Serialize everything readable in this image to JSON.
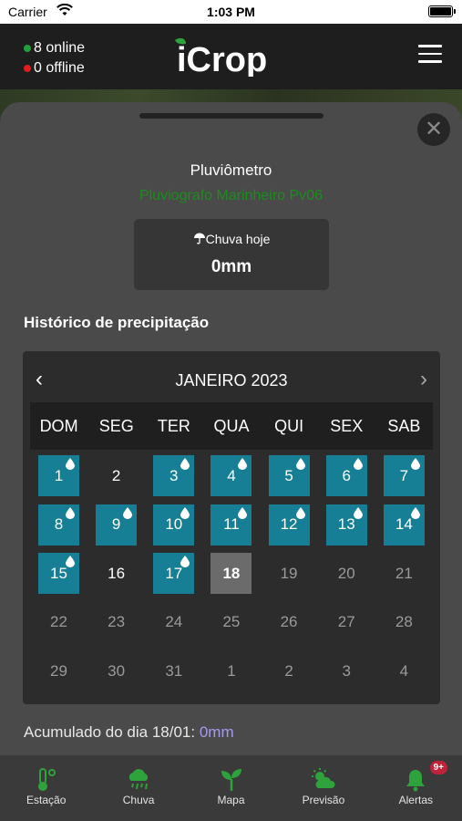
{
  "status_bar": {
    "carrier": "Carrier",
    "time": "1:03 PM"
  },
  "header": {
    "online": "8 online",
    "offline": "0 offline",
    "logo_text": "iCrop",
    "colors": {
      "online_dot": "#1fa23a",
      "offline_dot": "#e01e1e",
      "logo_green": "#2fa33b"
    }
  },
  "modal": {
    "title": "Pluviômetro",
    "subtitle": "Pluviografo Marinheiro Pv06",
    "rain_today_label": "Chuva hoje",
    "rain_today_value": "0mm",
    "history_title": "Histórico de precipitação",
    "accumulated_label": "Acumulado do dia 18/01:",
    "accumulated_value": "0mm"
  },
  "calendar": {
    "month": "JANEIRO 2023",
    "weekdays": [
      "DOM",
      "SEG",
      "TER",
      "QUA",
      "QUI",
      "SEX",
      "SAB"
    ],
    "weeks": [
      [
        {
          "d": "1",
          "s": "rain"
        },
        {
          "d": "2",
          "s": "plain"
        },
        {
          "d": "3",
          "s": "rain"
        },
        {
          "d": "4",
          "s": "rain"
        },
        {
          "d": "5",
          "s": "rain"
        },
        {
          "d": "6",
          "s": "rain"
        },
        {
          "d": "7",
          "s": "rain"
        }
      ],
      [
        {
          "d": "8",
          "s": "rain"
        },
        {
          "d": "9",
          "s": "rain"
        },
        {
          "d": "10",
          "s": "rain"
        },
        {
          "d": "11",
          "s": "rain"
        },
        {
          "d": "12",
          "s": "rain"
        },
        {
          "d": "13",
          "s": "rain"
        },
        {
          "d": "14",
          "s": "rain"
        }
      ],
      [
        {
          "d": "15",
          "s": "rain"
        },
        {
          "d": "16",
          "s": "plain"
        },
        {
          "d": "17",
          "s": "rain"
        },
        {
          "d": "18",
          "s": "today"
        },
        {
          "d": "19",
          "s": "muted"
        },
        {
          "d": "20",
          "s": "muted"
        },
        {
          "d": "21",
          "s": "muted"
        }
      ],
      [
        {
          "d": "22",
          "s": "muted"
        },
        {
          "d": "23",
          "s": "muted"
        },
        {
          "d": "24",
          "s": "muted"
        },
        {
          "d": "25",
          "s": "muted"
        },
        {
          "d": "26",
          "s": "muted"
        },
        {
          "d": "27",
          "s": "muted"
        },
        {
          "d": "28",
          "s": "muted"
        }
      ],
      [
        {
          "d": "29",
          "s": "muted"
        },
        {
          "d": "30",
          "s": "muted"
        },
        {
          "d": "31",
          "s": "muted"
        },
        {
          "d": "1",
          "s": "muted"
        },
        {
          "d": "2",
          "s": "muted"
        },
        {
          "d": "3",
          "s": "muted"
        },
        {
          "d": "4",
          "s": "muted"
        }
      ]
    ],
    "colors": {
      "rain_day": "#167f95",
      "selected_day": "#6b6b6b"
    }
  },
  "tabs": [
    {
      "label": "Estação",
      "icon": "thermometer-icon"
    },
    {
      "label": "Chuva",
      "icon": "rain-cloud-icon"
    },
    {
      "label": "Mapa",
      "icon": "sprout-icon"
    },
    {
      "label": "Previsão",
      "icon": "sun-cloud-icon"
    },
    {
      "label": "Alertas",
      "icon": "bell-icon",
      "badge": "9+"
    }
  ]
}
